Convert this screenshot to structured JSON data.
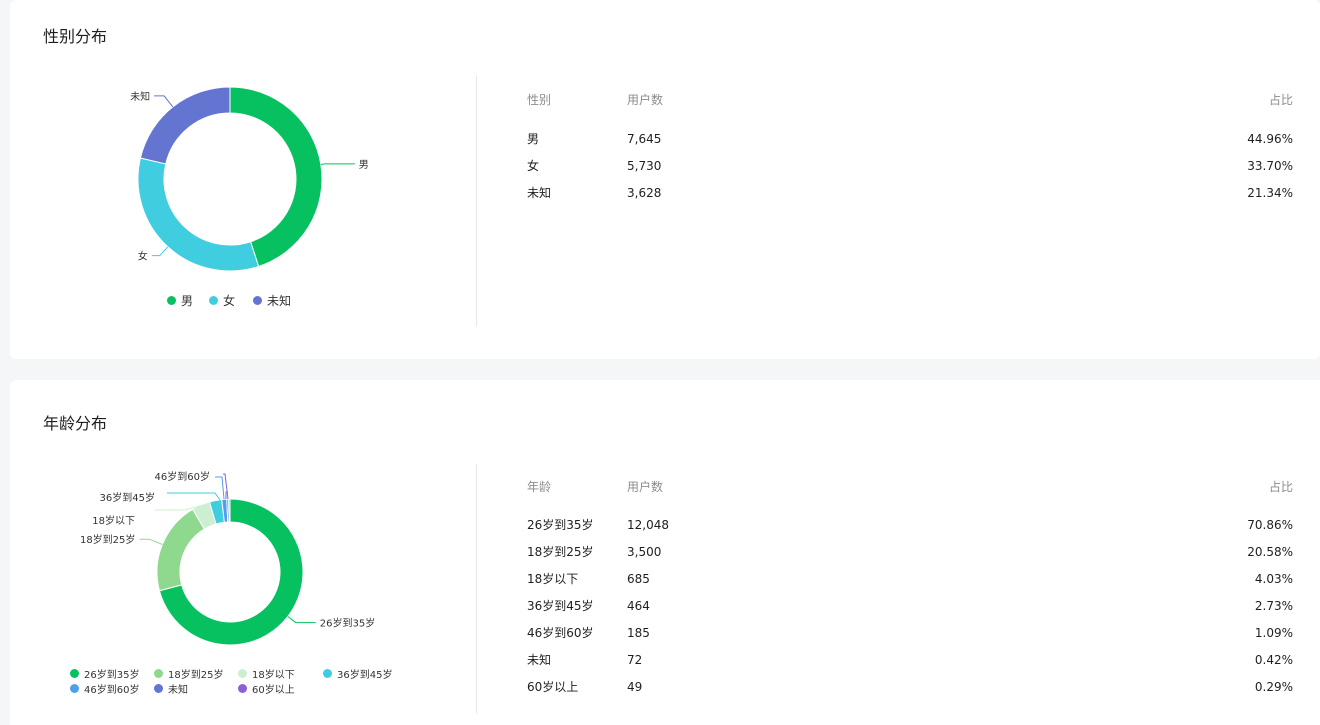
{
  "gender": {
    "title": "性别分布",
    "table": {
      "headers": [
        "性别",
        "用户数",
        "占比"
      ],
      "rows": [
        [
          "男",
          "7,645",
          "44.96%"
        ],
        [
          "女",
          "5,730",
          "33.70%"
        ],
        [
          "未知",
          "3,628",
          "21.34%"
        ]
      ]
    }
  },
  "age": {
    "title": "年龄分布",
    "table": {
      "headers": [
        "年龄",
        "用户数",
        "占比"
      ],
      "rows": [
        [
          "26岁到35岁",
          "12,048",
          "70.86%"
        ],
        [
          "18岁到25岁",
          "3,500",
          "20.58%"
        ],
        [
          "18岁以下",
          "685",
          "4.03%"
        ],
        [
          "36岁到45岁",
          "464",
          "2.73%"
        ],
        [
          "46岁到60岁",
          "185",
          "1.09%"
        ],
        [
          "未知",
          "72",
          "0.42%"
        ],
        [
          "60岁以上",
          "49",
          "0.29%"
        ]
      ]
    }
  },
  "chart_data": [
    {
      "type": "pie",
      "variant": "donut",
      "categories": [
        "男",
        "女",
        "未知"
      ],
      "values": [
        7645,
        5730,
        3628
      ],
      "colors": [
        "#07c160",
        "#40cde0",
        "#6375d1"
      ],
      "legend_position": "bottom"
    },
    {
      "type": "pie",
      "variant": "donut",
      "categories": [
        "26岁到35岁",
        "18岁到25岁",
        "18岁以下",
        "36岁到45岁",
        "46岁到60岁",
        "未知",
        "60岁以上"
      ],
      "values": [
        12048,
        3500,
        685,
        464,
        185,
        72,
        49
      ],
      "colors": [
        "#07c160",
        "#8fd98f",
        "#cdefd1",
        "#40cde0",
        "#4d9fec",
        "#6375d1",
        "#8a5fd8"
      ],
      "legend_position": "bottom"
    }
  ]
}
